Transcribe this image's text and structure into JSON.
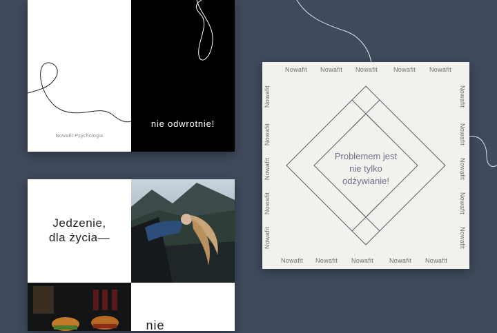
{
  "mockup": {
    "top_left_card": {
      "caption": "Nowafit Psychologia",
      "quote": "nie odwrotnie!"
    },
    "bottom_left_card": {
      "headline_line1": "Jedzenie,",
      "headline_line2": "dla życia—",
      "partial_text": "nie"
    },
    "right_card": {
      "brand": "Nowafit",
      "quote_line1": "Problemem jest",
      "quote_line2": "nie tylko",
      "quote_line3": "odżywianie!"
    }
  },
  "colors": {
    "background": "#3f4a5c",
    "quote_text": "#6a7088",
    "card_paper": "#f3f1ee"
  }
}
